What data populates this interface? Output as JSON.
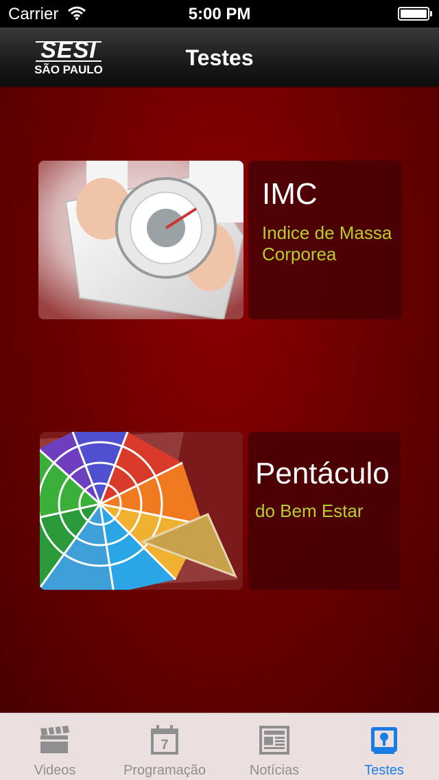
{
  "status_bar": {
    "carrier": "Carrier",
    "time": "5:00 PM",
    "wifi_icon": "wifi-icon",
    "battery_icon": "battery-icon"
  },
  "nav_bar": {
    "logo_top": "SESI",
    "logo_bottom": "SÃO PAULO",
    "title": "Testes"
  },
  "cards": [
    {
      "title": "IMC",
      "subtitle": "Indice de Massa Corporea",
      "image_icon": "scale-photo"
    },
    {
      "title": "Pentáculo",
      "subtitle": "do Bem Estar",
      "image_icon": "pentacle-star-graphic"
    }
  ],
  "tab_bar": {
    "tabs": [
      {
        "label": "Videos",
        "icon": "clapperboard-icon",
        "active": false
      },
      {
        "label": "Programação",
        "icon": "calendar-icon",
        "active": false
      },
      {
        "label": "Notícias",
        "icon": "newspaper-icon",
        "active": false
      },
      {
        "label": "Testes",
        "icon": "test-box-icon",
        "active": true
      }
    ]
  },
  "colors": {
    "accent_active_tab": "#1a7de6",
    "subtitle_green": "#b6cf2a",
    "background_red": "#7a0000"
  }
}
